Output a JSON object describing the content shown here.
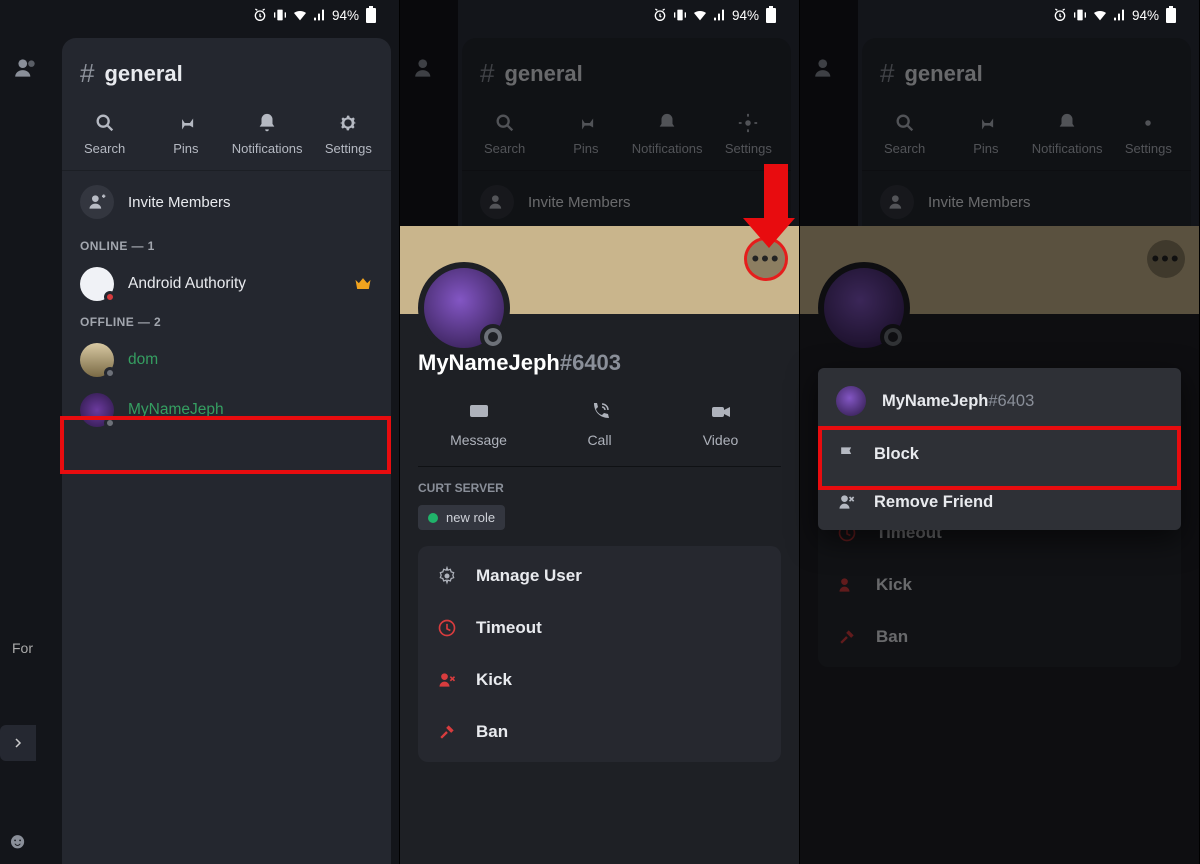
{
  "status": {
    "battery": "94%"
  },
  "channel": {
    "name": "general"
  },
  "actions": {
    "search": "Search",
    "pins": "Pins",
    "notifications": "Notifications",
    "settings": "Settings"
  },
  "invite": "Invite Members",
  "sections": {
    "online": "ONLINE — 1",
    "offline": "OFFLINE — 2"
  },
  "members": {
    "aa": "Android Authority",
    "dom": "dom",
    "jeph": "MyNameJeph"
  },
  "sidebar": {
    "for": "For"
  },
  "profile": {
    "name": "MyNameJeph",
    "tag": "#6403",
    "message": "Message",
    "call": "Call",
    "video": "Video",
    "server_head": "CURT SERVER",
    "role": "new role",
    "manage": "Manage User",
    "timeout": "Timeout",
    "kick": "Kick",
    "ban": "Ban"
  },
  "popup": {
    "name": "MyNameJeph",
    "tag": "#6403",
    "block": "Block",
    "remove": "Remove Friend"
  }
}
